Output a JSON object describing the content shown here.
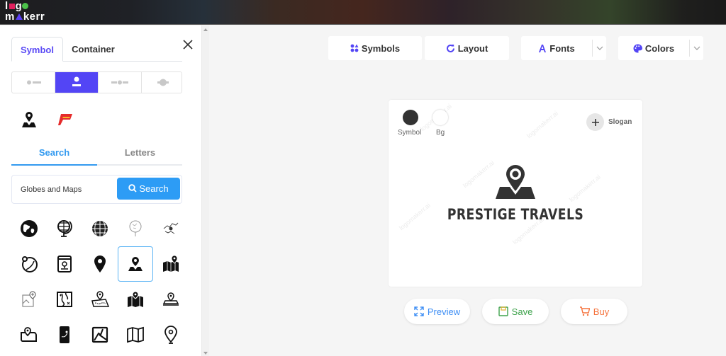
{
  "header": {
    "logo_line1": "logo",
    "logo_line2": "makerr"
  },
  "sidebar": {
    "tabs": [
      {
        "label": "Symbol",
        "active": true
      },
      {
        "label": "Container",
        "active": false
      }
    ],
    "layout_options": [
      {
        "name": "symbol-left",
        "active": false
      },
      {
        "name": "symbol-top",
        "active": true
      },
      {
        "name": "symbol-middle",
        "active": false
      },
      {
        "name": "symbol-behind",
        "active": false
      }
    ],
    "recent_symbols": [
      "map-pin-on-map",
      "red-p-logo"
    ],
    "search_tabs": [
      {
        "label": "Search",
        "active": true
      },
      {
        "label": "Letters",
        "active": false
      }
    ],
    "search": {
      "value": "Globes and Maps",
      "button_label": "Search"
    },
    "icons": [
      "earth-globe",
      "desk-globe",
      "wire-globe",
      "tree-globe",
      "world-map-pin",
      "pinned-planet",
      "map-card",
      "location-pin",
      "map-pin-on-map",
      "folded-map-pin",
      "image-location-add",
      "treasure-map",
      "route-map",
      "map-with-pin",
      "pin-on-mat",
      "scroll-map-pin",
      "phone-map",
      "square-map",
      "folded-map",
      "location-pin-outline"
    ],
    "selected_icon_index": 8
  },
  "toolbar": {
    "symbols": "Symbols",
    "layout": "Layout",
    "fonts": "Fonts",
    "colors": "Colors"
  },
  "canvas": {
    "symbol_label": "Symbol",
    "bg_label": "Bg",
    "symbol_color": "#333333",
    "bg_color": "#ffffff",
    "slogan_label": "Slogan",
    "brand_name": "PRESTIGE TRAVELS",
    "watermark": "logomakerr.ai"
  },
  "actions": {
    "preview": "Preview",
    "save": "Save",
    "buy": "Buy"
  },
  "colors": {
    "accent": "#5345f5",
    "search_blue": "#2d9cf5",
    "save_green": "#3fa34d",
    "buy_orange": "#f5733d",
    "preview_blue": "#3d8ef5"
  }
}
